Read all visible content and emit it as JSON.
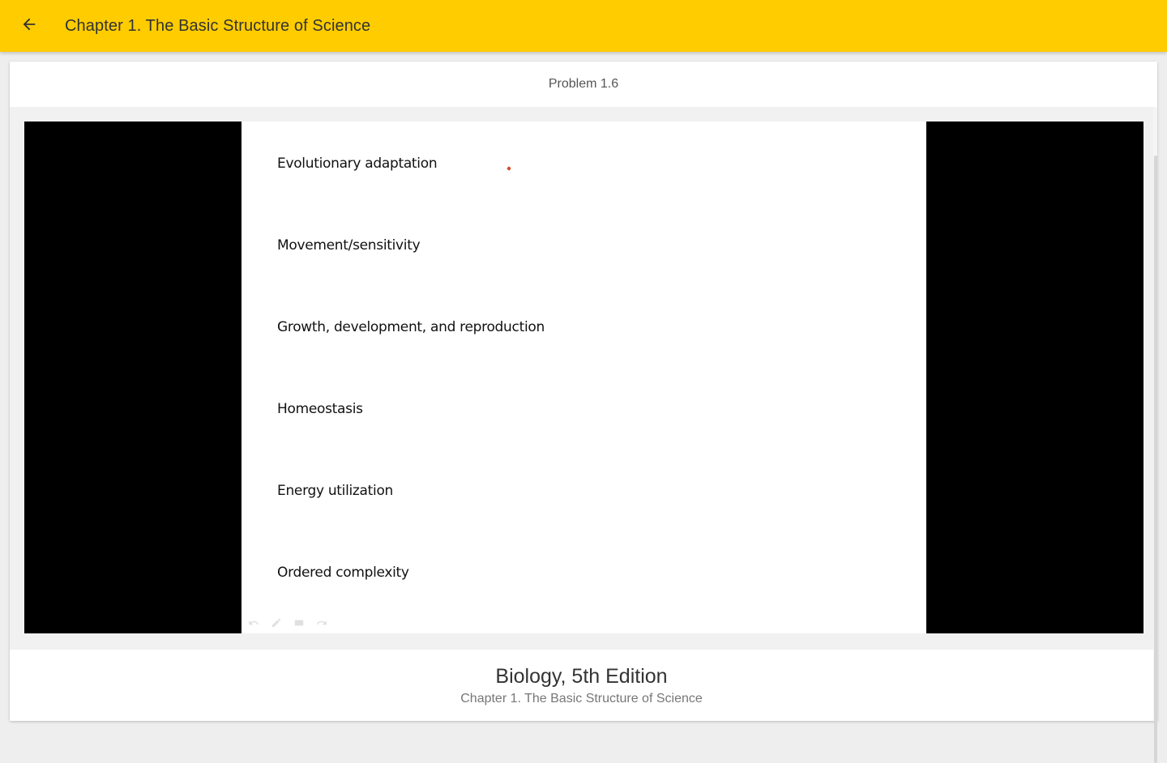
{
  "appbar": {
    "back_icon": "arrow-left-icon",
    "title": "Chapter 1. The Basic Structure of Science",
    "background": "#ffcc00"
  },
  "problem": {
    "label": "Problem 1.6"
  },
  "video": {
    "slide_items": [
      "Evolutionary adaptation",
      "Movement/sensitivity",
      "Growth, development, and reproduction",
      "Homeostasis",
      "Energy utilization",
      "Ordered complexity"
    ],
    "toolbar_icons": [
      "undo-icon",
      "pen-icon",
      "eraser-icon",
      "redo-icon"
    ]
  },
  "footer": {
    "book_title": "Biology, 5th Edition",
    "chapter": "Chapter 1. The Basic Structure of Science"
  }
}
